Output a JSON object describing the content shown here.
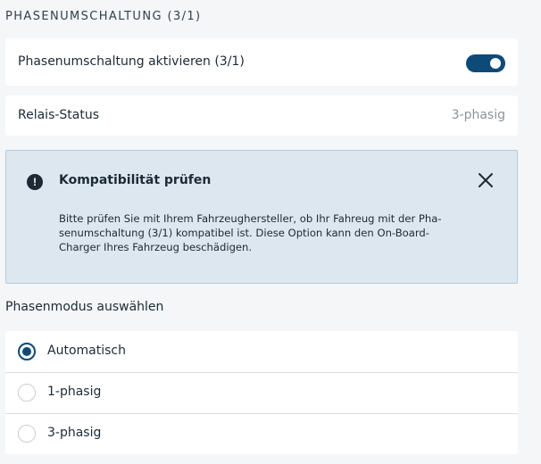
{
  "section": {
    "title": "PHASENUMSCHALTUNG (3/1)"
  },
  "phase_switch": {
    "label": "Phasenumschaltung aktivieren (3/1)",
    "enabled": true
  },
  "relay": {
    "label": "Relais-Status",
    "value": "3-phasig"
  },
  "alert": {
    "icon": "exclamation-icon",
    "title": "Kompatibilität prüfen",
    "lines": [
      "Bitte prüfen Sie mit Ihrem Fahrzeughersteller, ob Ihr Fahreug mit der Pha-",
      "senumschaltung (3/1) kompatibel ist. Diese Option kann den On-Board-",
      "Charger Ihres Fahrzeug beschädigen."
    ]
  },
  "phase_mode": {
    "heading": "Phasenmodus auswählen",
    "selected": "Automatisch",
    "options": [
      "Automatisch",
      "1-phasig",
      "3-phasig"
    ]
  },
  "colors": {
    "accent": "#0d4a78",
    "alert_bg": "#dde7ef",
    "alert_border": "#b6cad9"
  }
}
